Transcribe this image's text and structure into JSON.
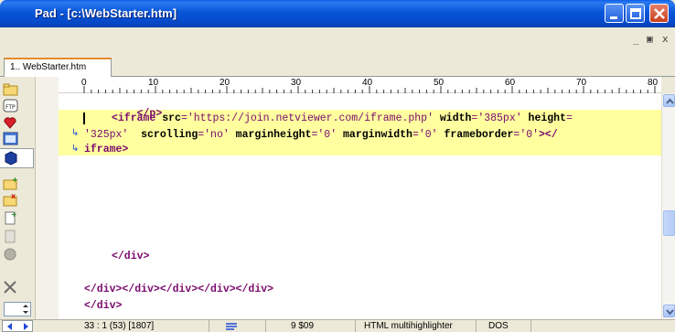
{
  "window": {
    "title": "Pad - [c:\\WebStarter.htm]"
  },
  "mdi": {
    "minimize": "_",
    "restore": "▣",
    "close": "x"
  },
  "tabs": [
    {
      "label": "1.. WebStarter.htm"
    }
  ],
  "ruler": {
    "ticks": [
      "0",
      "10",
      "20",
      "30",
      "40",
      "50",
      "60",
      "70",
      "80"
    ]
  },
  "editor": {
    "lines": {
      "close_p": "</p>",
      "iframe_open": "<iframe",
      "attr_src": "src",
      "val_src": "'https://join.netviewer.com/iframe.php'",
      "attr_width": "width",
      "val_width": "'385px'",
      "attr_height": "height",
      "val_height": "'325px'",
      "attr_scrolling": "scrolling",
      "val_scrolling": "'no'",
      "attr_marginheight": "marginheight",
      "val_marginheight": "'0'",
      "attr_marginwidth": "marginwidth",
      "val_marginwidth": "'0'",
      "attr_frameborder": "frameborder",
      "val_frameborder": "'0'",
      "close_iframe_a": "></",
      "close_iframe_b": "iframe>",
      "close_div": "</div>",
      "close_divs": "</div></div></div></div></div>",
      "close_div2": "</div>"
    }
  },
  "status": {
    "position": "33 : 1  (53)  [1807]",
    "col2": "9  $09",
    "highlighter": "HTML multihighlighter",
    "lineend": "DOS"
  },
  "colors": {
    "titlebar": "#0856D8",
    "highlight_line": "#FFFFA0",
    "tag": "#7A0A6E"
  }
}
